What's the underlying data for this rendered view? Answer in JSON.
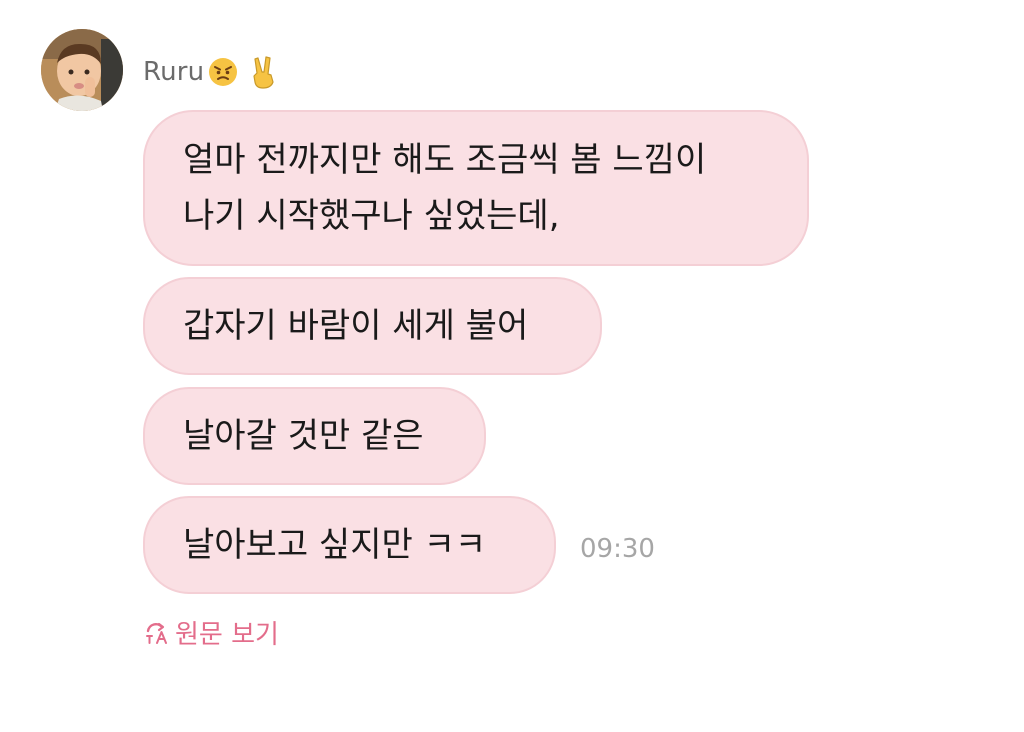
{
  "sender": {
    "name": "Ruru",
    "emojis": [
      "angry-face-emoji",
      "victory-hand-emoji"
    ]
  },
  "messages": [
    {
      "text": "얼마 전까지만 해도 조금씩 봄 느낌이\n나기 시작했구나 싶었는데,"
    },
    {
      "text": "갑자기 바람이 세게 불어"
    },
    {
      "text": "날아갈 것만 같은"
    },
    {
      "text": "날아보고 싶지만 ㅋㅋ"
    }
  ],
  "timestamp": "09:30",
  "translate_link": {
    "label": "원문 보기",
    "icon": "translate-icon"
  },
  "colors": {
    "bubble": "#fae0e4",
    "bubble_border": "#f4cfd5",
    "link": "#e36d8b",
    "timestamp": "#a6a6a6",
    "sender_name": "#6b6b6b"
  }
}
